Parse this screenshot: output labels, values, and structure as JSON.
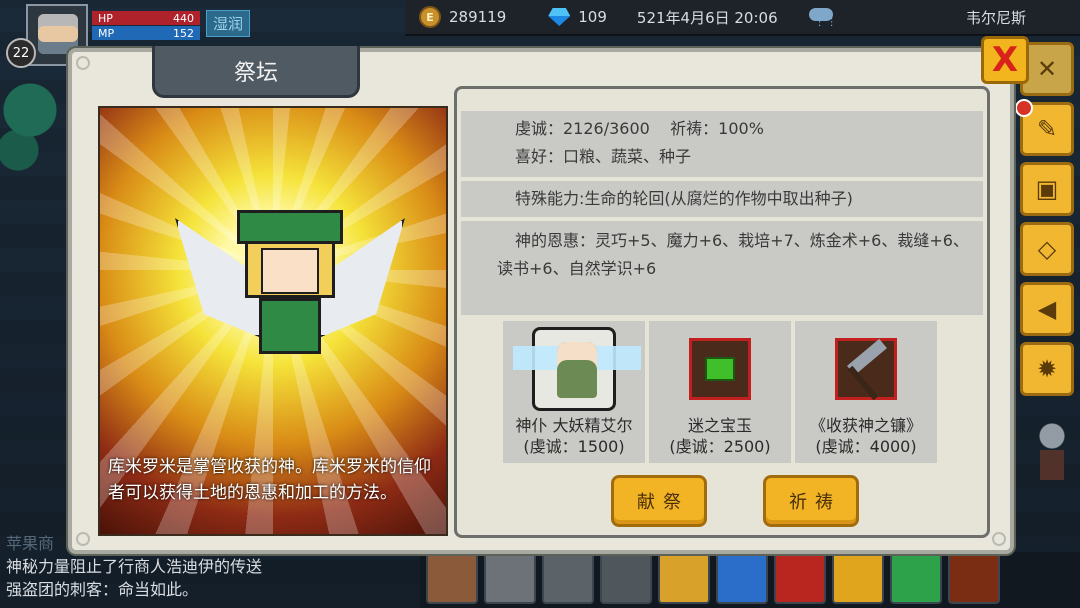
{
  "hud": {
    "coins": "289119",
    "gems": "109",
    "datetime": "521年4月6日  20:06",
    "location": "韦尔尼斯"
  },
  "player": {
    "level": "22",
    "hp_label": "HP",
    "hp_value": "440",
    "mp_label": "MP",
    "mp_value": "152",
    "status": "湿润"
  },
  "chat": [
    "苹果商",
    "神秘力量阻止了行商人浩迪伊的传送",
    "强盗团的刺客：命当如此。"
  ],
  "dialog": {
    "title": "祭坛",
    "close_label": "X",
    "lore": "库米罗米是掌管收获的神。库米罗米的信仰者可以获得土地的恩惠和加工的方法。",
    "devotion_line": "虔诚：2126/3600    祈祷：100%",
    "likes_line": "喜好：口粮、蔬菜、种子",
    "ability_line": "特殊能力:生命的轮回(从腐烂的作物中取出种子)",
    "blessing_line": "神的恩惠：灵巧+5、魔力+6、栽培+7、炼金术+6、裁缝+6、读书+6、自然学识+6",
    "offerings": [
      {
        "name": "神仆 大妖精艾尔",
        "cost": "(虔诚：1500)",
        "icon": "fairy-servant-icon"
      },
      {
        "name": "迷之宝玉",
        "cost": "(虔诚：2500)",
        "icon": "green-gem-icon"
      },
      {
        "name": "《收获神之镰》",
        "cost": "(虔诚：4000)",
        "icon": "scythe-icon"
      }
    ],
    "offer_button": "献祭",
    "pray_button": "祈祷"
  },
  "colors": {
    "accent_button": "#f2b325",
    "close_red": "#d8231a",
    "panel_bg": "#e9e7dc",
    "row_bg": "#c9cac6"
  }
}
